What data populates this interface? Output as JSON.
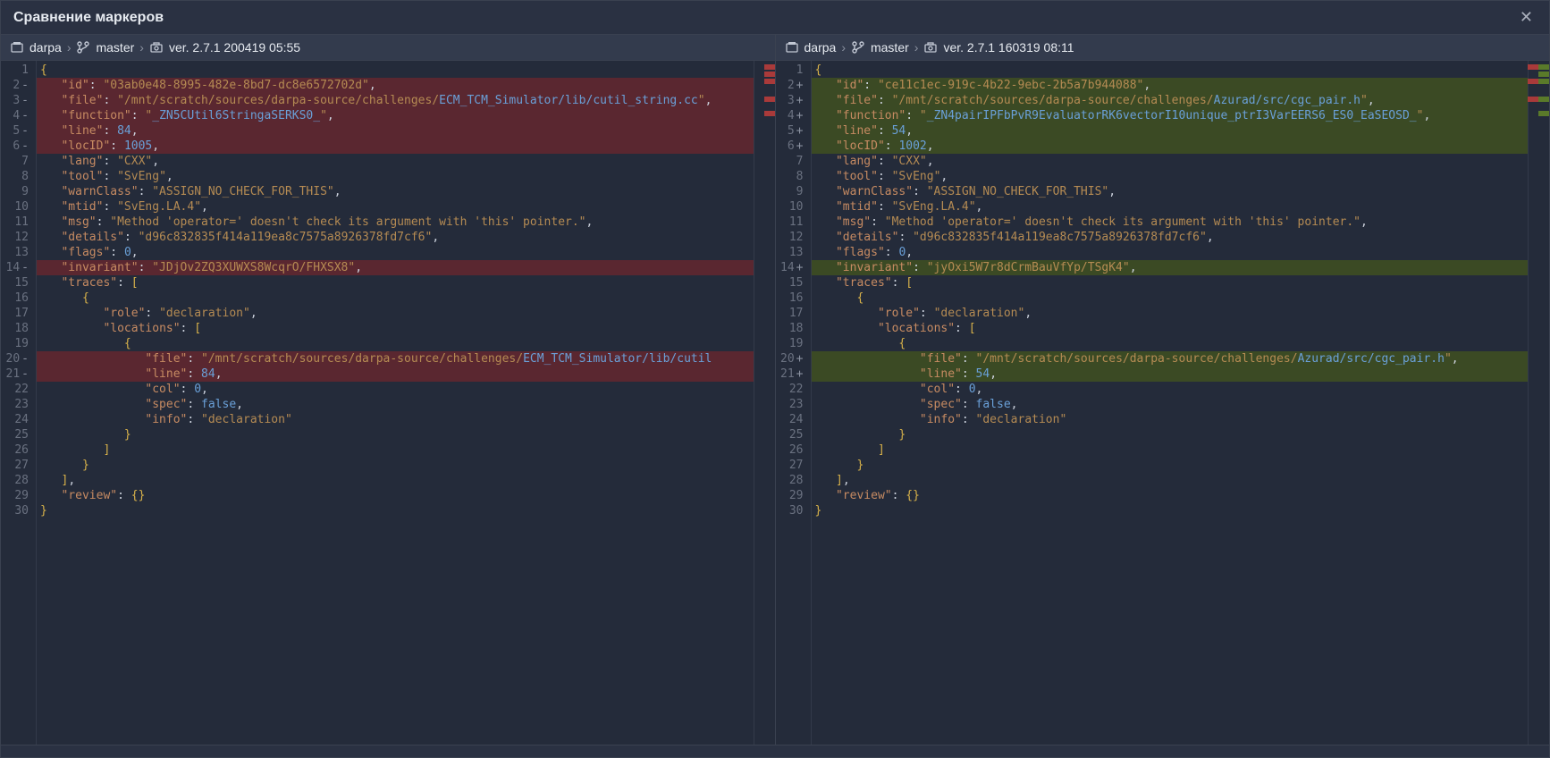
{
  "window": {
    "title": "Сравнение маркеров"
  },
  "left": {
    "crumb_project": "darpa",
    "crumb_branch": "master",
    "crumb_version": "ver. 2.7.1 200419 05:55",
    "id": "03ab0e48-8995-482e-8bd7-dc8e6572702d",
    "file": "/mnt/scratch/sources/darpa-source/challenges/ECM_TCM_Simulator/lib/cutil_string.cc",
    "function": "_ZN5CUtil6StringaSERKS0_",
    "line": 84,
    "locID": 1005,
    "lang": "CXX",
    "tool": "SvEng",
    "warnClass": "ASSIGN_NO_CHECK_FOR_THIS",
    "mtid": "SvEng.LA.4",
    "msg": "Method 'operator=' doesn't check its argument with 'this' pointer.",
    "details": "d96c832835f414a119ea8c7575a8926378fd7cf6",
    "flags": 0,
    "invariant": "JDjOv2ZQ3XUWXS8WcqrO/FHXSX8",
    "trace_role": "declaration",
    "trace_file": "/mnt/scratch/sources/darpa-source/challenges/ECM_TCM_Simulator/lib/cutil",
    "trace_line": 84,
    "trace_col": 0,
    "trace_spec": "false",
    "trace_info": "declaration",
    "review": "{}"
  },
  "right": {
    "crumb_project": "darpa",
    "crumb_branch": "master",
    "crumb_version": "ver. 2.7.1 160319 08:11",
    "id": "ce11c1ec-919c-4b22-9ebc-2b5a7b944088",
    "file": "/mnt/scratch/sources/darpa-source/challenges/Azurad/src/cgc_pair.h",
    "function": "_ZN4pairIPFbPvR9EvaluatorRK6vectorI10unique_ptrI3VarEERS6_ES0_EaSEOSD_",
    "line": 54,
    "locID": 1002,
    "lang": "CXX",
    "tool": "SvEng",
    "warnClass": "ASSIGN_NO_CHECK_FOR_THIS",
    "mtid": "SvEng.LA.4",
    "msg": "Method 'operator=' doesn't check its argument with 'this' pointer.",
    "details": "d96c832835f414a119ea8c7575a8926378fd7cf6",
    "flags": 0,
    "invariant": "jyOxi5W7r8dCrmBauVfYp/TSgK4",
    "trace_role": "declaration",
    "trace_file": "/mnt/scratch/sources/darpa-source/challenges/Azurad/src/cgc_pair.h",
    "trace_line": 54,
    "trace_col": 0,
    "trace_spec": "false",
    "trace_info": "declaration",
    "review": "{}"
  }
}
